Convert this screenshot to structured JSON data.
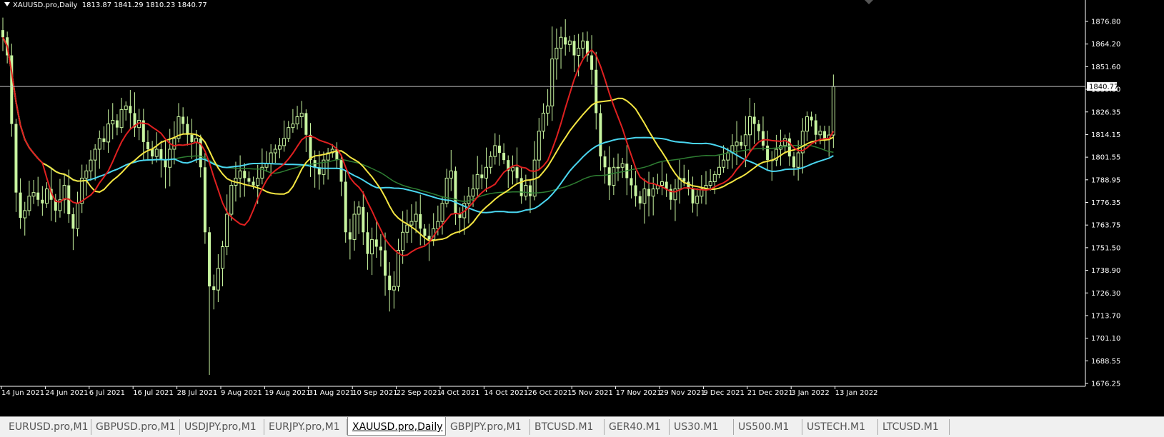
{
  "chart_header": {
    "symbol": "XAUUSD.pro,Daily",
    "ohlc": "1813.87 1841.29 1810.23 1840.77"
  },
  "chart_data": {
    "type": "candlestick",
    "y_ticks": [
      "1876.80",
      "1864.20",
      "1851.60",
      "1839.00",
      "1826.35",
      "1814.15",
      "1801.55",
      "1788.95",
      "1776.35",
      "1763.75",
      "1751.50",
      "1738.90",
      "1726.30",
      "1713.70",
      "1701.10",
      "1688.55",
      "1676.25"
    ],
    "ylim": [
      1676.25,
      1876.8
    ],
    "x_ticks": [
      "14 Jun 2021",
      "24 Jun 2021",
      "6 Jul 2021",
      "16 Jul 2021",
      "28 Jul 2021",
      "9 Aug 2021",
      "19 Aug 2021",
      "31 Aug 2021",
      "10 Sep 2021",
      "22 Sep 2021",
      "4 Oct 2021",
      "14 Oct 2021",
      "26 Oct 2021",
      "5 Nov 2021",
      "17 Nov 2021",
      "29 Nov 2021",
      "9 Dec 2021",
      "21 Dec 2021",
      "3 Jan 2022",
      "13 Jan 2022"
    ],
    "last_price": "1840.77",
    "closes": [
      1868,
      1858,
      1820,
      1782,
      1768,
      1772,
      1780,
      1782,
      1778,
      1776,
      1784,
      1778,
      1772,
      1778,
      1786,
      1770,
      1762,
      1776,
      1790,
      1794,
      1800,
      1806,
      1812,
      1810,
      1820,
      1822,
      1818,
      1828,
      1830,
      1826,
      1818,
      1822,
      1810,
      1806,
      1802,
      1806,
      1800,
      1796,
      1806,
      1812,
      1824,
      1820,
      1814,
      1810,
      1812,
      1796,
      1760,
      1730,
      1728,
      1740,
      1752,
      1770,
      1786,
      1790,
      1794,
      1790,
      1788,
      1786,
      1790,
      1796,
      1798,
      1804,
      1806,
      1808,
      1812,
      1818,
      1820,
      1824,
      1826,
      1814,
      1800,
      1796,
      1792,
      1800,
      1804,
      1806,
      1800,
      1788,
      1760,
      1756,
      1770,
      1774,
      1760,
      1748,
      1756,
      1752,
      1750,
      1736,
      1728,
      1730,
      1750,
      1760,
      1764,
      1766,
      1770,
      1762,
      1758,
      1756,
      1762,
      1766,
      1776,
      1790,
      1794,
      1770,
      1768,
      1776,
      1780,
      1784,
      1792,
      1790,
      1796,
      1802,
      1808,
      1804,
      1800,
      1794,
      1796,
      1790,
      1780,
      1786,
      1780,
      1800,
      1816,
      1826,
      1830,
      1856,
      1862,
      1868,
      1864,
      1866,
      1858,
      1862,
      1866,
      1858,
      1850,
      1826,
      1802,
      1796,
      1786,
      1796,
      1796,
      1798,
      1790,
      1786,
      1780,
      1776,
      1784,
      1780,
      1784,
      1786,
      1788,
      1784,
      1778,
      1784,
      1790,
      1788,
      1784,
      1776,
      1780,
      1784,
      1786,
      1788,
      1792,
      1796,
      1800,
      1804,
      1808,
      1810,
      1808,
      1814,
      1824,
      1820,
      1816,
      1808,
      1800,
      1800,
      1806,
      1808,
      1812,
      1802,
      1796,
      1804,
      1816,
      1824,
      1822,
      1814,
      1816,
      1812,
      1813.87,
      1840.77
    ]
  },
  "tabs": [
    {
      "label": "EURUSD.pro,M1"
    },
    {
      "label": "GBPUSD.pro,M1"
    },
    {
      "label": "USDJPY.pro,M1"
    },
    {
      "label": "EURJPY.pro,M1"
    },
    {
      "label": "XAUUSD.pro,Daily",
      "active": true
    },
    {
      "label": "GBPJPY.pro,M1"
    },
    {
      "label": "BTCUSD.M1"
    },
    {
      "label": "GER40.M1"
    },
    {
      "label": "US30.M1"
    },
    {
      "label": "US500.M1"
    },
    {
      "label": "USTECH.M1"
    },
    {
      "label": "LTCUSD.M1"
    }
  ],
  "colors": {
    "bull": "#c8f5a0",
    "bear": "#c8f5a0",
    "ma_red": "#e02020",
    "ma_yellow": "#f5e642",
    "ma_cyan": "#4ad6f0",
    "ma_green": "#2e7d32",
    "grid_line": "#c0c0c0"
  }
}
